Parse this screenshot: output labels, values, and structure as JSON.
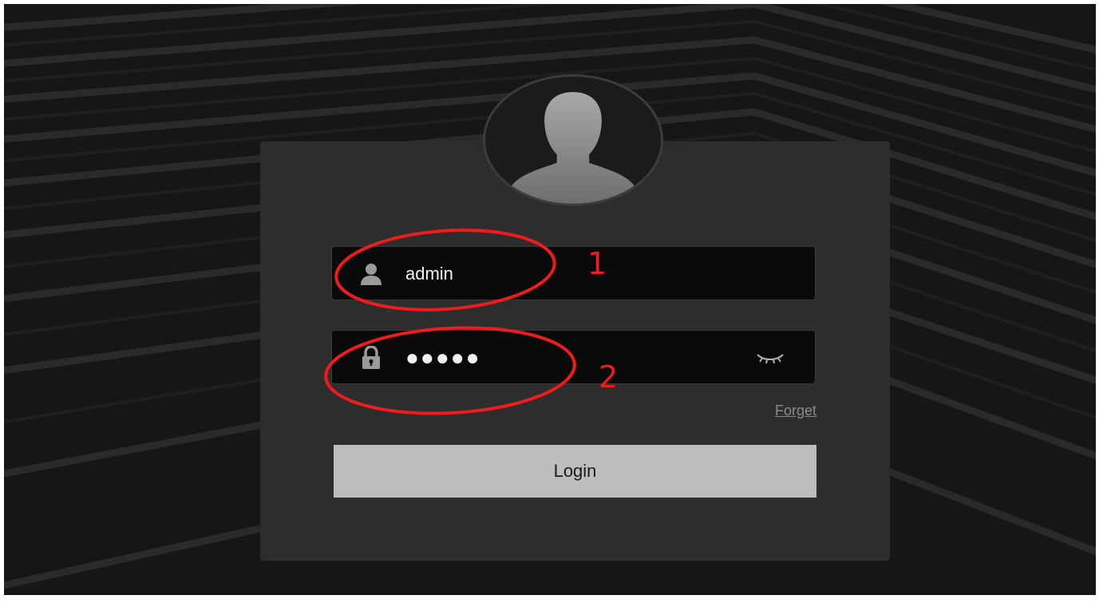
{
  "login_form": {
    "username": {
      "value": "admin",
      "icon": "user-icon"
    },
    "password": {
      "masked_value": "●●●●●",
      "icon": "lock-icon",
      "toggle_icon": "eye-closed-icon"
    },
    "forget_link": "Forget",
    "login_button": "Login",
    "avatar_icon": "user-silhouette-icon"
  },
  "annotations": {
    "marker_1": "1",
    "marker_2": "2",
    "color": "#ee1c1c"
  },
  "colors": {
    "background": "#161616",
    "card": "#2d2d2d",
    "field": "#0a0a0a",
    "button": "#bdbdbd",
    "link": "#8a8a8a"
  }
}
